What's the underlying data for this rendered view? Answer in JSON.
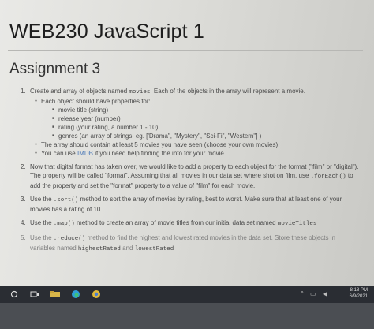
{
  "doc": {
    "title": "WEB230 JavaScript 1",
    "section": "Assignment 3"
  },
  "items": {
    "q1": {
      "num": "1.",
      "a": "Create and array of objects named ",
      "code": "movies",
      "b": ". Each of the objects in the array will represent a movie.",
      "s1": "Each object should have properties for:",
      "props": [
        "movie title (string)",
        "release year (number)",
        "rating (your rating, a number 1 - 10)",
        "genres (an array of strings, eg. ['Drama\", \"Mystery\", \"Sci-Fi\", \"Western\"] )"
      ],
      "s2": "The array should contain at least 5 movies you have seen (choose your own movies)",
      "s3a": "You can use ",
      "s3link": "IMDB",
      "s3b": " if you need help finding the info for your movie"
    },
    "q2": {
      "num": "2.",
      "a": "Now that digital format has taken over, we would like to add a property to each object for the format (\"film\" or \"digital\"). The property will be called \"format\". Assuming that all movies in our data set where shot on film, use ",
      "code": ".forEach()",
      "b": " to add the property and set the \"format\" property to a value of \"film\" for each movie."
    },
    "q3": {
      "num": "3.",
      "a": "Use the ",
      "code": ".sort()",
      "b": " method to sort the array of movies by rating, best to worst. Make sure that at least one of your movies has a rating of 10."
    },
    "q4": {
      "num": "4.",
      "a": "Use the ",
      "code": ".map()",
      "b": " method to create an array of movie titles from our initial data set named ",
      "code2": "movieTitles"
    },
    "q5": {
      "num": "5.",
      "a": "Use the ",
      "code": ".reduce()",
      "b": " method to find the highest and lowest rated movies in the data set. Store these objects in variables named ",
      "code2": "highestRated",
      "c": " and ",
      "code3": "lowestRated"
    }
  },
  "taskbar": {
    "time": "8:18 PM",
    "date": "6/9/2021"
  }
}
